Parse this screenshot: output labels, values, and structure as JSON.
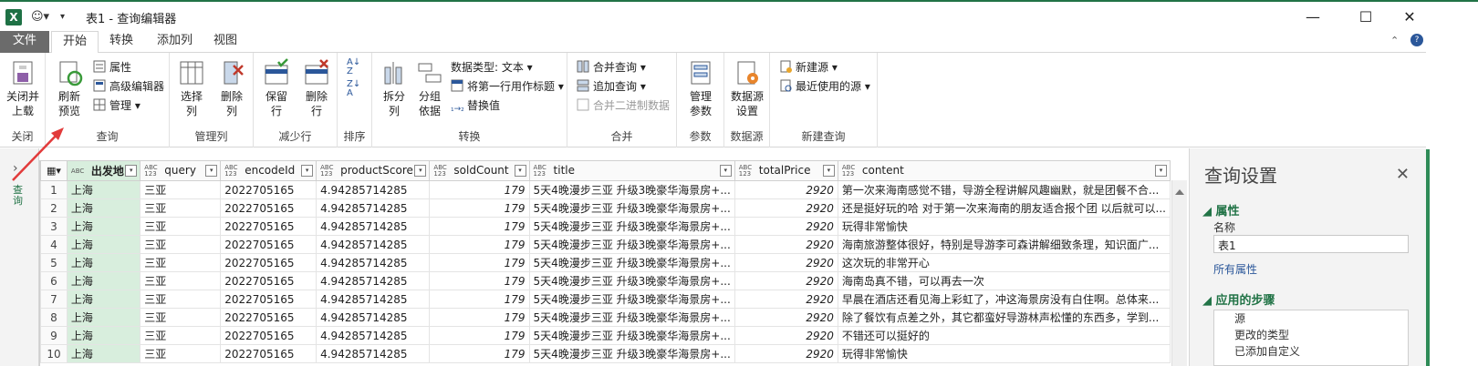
{
  "titlebar": {
    "app_icon": "X",
    "title": "表1 - 查询编辑器",
    "minimize": "—",
    "maximize": "☐",
    "close": "✕"
  },
  "tabs": [
    "文件",
    "开始",
    "转换",
    "添加列",
    "视图"
  ],
  "ribbon": {
    "close_group": {
      "btn": "关闭并\n上载",
      "label": "关闭"
    },
    "query_group": {
      "refresh": "刷新\n预览",
      "props": "属性",
      "adv_editor": "高级编辑器",
      "manage": "管理",
      "label": "查询"
    },
    "manage_cols": {
      "choose": "选择\n列",
      "remove": "删除\n列",
      "label": "管理列"
    },
    "reduce_rows": {
      "keep": "保留\n行",
      "remove": "删除\n行",
      "label": "减少行"
    },
    "sort": {
      "label": "排序"
    },
    "transform": {
      "split": "拆分\n列",
      "group": "分组\n依据",
      "dtype": "数据类型: 文本",
      "first_row": "将第一行用作标题",
      "replace": "替换值",
      "label": "转换"
    },
    "combine": {
      "merge": "合并查询",
      "append": "追加查询",
      "binary": "合并二进制数据",
      "label": "合并"
    },
    "params": {
      "manage": "管理\n参数",
      "label": "参数"
    },
    "datasource": {
      "settings": "数据源\n设置",
      "label": "数据源"
    },
    "newquery": {
      "new_src": "新建源",
      "recent": "最近使用的源",
      "label": "新建查询"
    }
  },
  "leftnav": {
    "label": "查询"
  },
  "grid": {
    "columns": [
      {
        "name": "出发地",
        "type": "ABC"
      },
      {
        "name": "query",
        "type": "ABC\n123"
      },
      {
        "name": "encodeId",
        "type": "ABC\n123"
      },
      {
        "name": "productScore",
        "type": "ABC\n123"
      },
      {
        "name": "soldCount",
        "type": "ABC\n123"
      },
      {
        "name": "title",
        "type": "ABC\n123"
      },
      {
        "name": "totalPrice",
        "type": "ABC\n123"
      },
      {
        "name": "content",
        "type": "ABC\n123"
      }
    ],
    "rows": [
      [
        "1",
        "上海",
        "三亚",
        "2022705165",
        "4.94285714285",
        "179",
        "5天4晚漫步三亚 升级3晚豪华海景房+...",
        "2920",
        "第一次来海南感觉不错，导游全程讲解风趣幽默，就是团餐不合..."
      ],
      [
        "2",
        "上海",
        "三亚",
        "2022705165",
        "4.94285714285",
        "179",
        "5天4晚漫步三亚 升级3晚豪华海景房+...",
        "2920",
        "还是挺好玩的哈 对于第一次来海南的朋友适合报个团 以后就可以..."
      ],
      [
        "3",
        "上海",
        "三亚",
        "2022705165",
        "4.94285714285",
        "179",
        "5天4晚漫步三亚 升级3晚豪华海景房+...",
        "2920",
        "玩得非常愉快"
      ],
      [
        "4",
        "上海",
        "三亚",
        "2022705165",
        "4.94285714285",
        "179",
        "5天4晚漫步三亚 升级3晚豪华海景房+...",
        "2920",
        "海南旅游整体很好，特别是导游李可森讲解细致条理，知识面广..."
      ],
      [
        "5",
        "上海",
        "三亚",
        "2022705165",
        "4.94285714285",
        "179",
        "5天4晚漫步三亚 升级3晚豪华海景房+...",
        "2920",
        "这次玩的非常开心"
      ],
      [
        "6",
        "上海",
        "三亚",
        "2022705165",
        "4.94285714285",
        "179",
        "5天4晚漫步三亚 升级3晚豪华海景房+...",
        "2920",
        "海南岛真不错，可以再去一次"
      ],
      [
        "7",
        "上海",
        "三亚",
        "2022705165",
        "4.94285714285",
        "179",
        "5天4晚漫步三亚 升级3晚豪华海景房+...",
        "2920",
        "早晨在酒店还看见海上彩虹了，冲这海景房没有白住啊。总体来..."
      ],
      [
        "8",
        "上海",
        "三亚",
        "2022705165",
        "4.94285714285",
        "179",
        "5天4晚漫步三亚 升级3晚豪华海景房+...",
        "2920",
        "除了餐饮有点差之外，其它都蛮好导游林声松懂的东西多，学到..."
      ],
      [
        "9",
        "上海",
        "三亚",
        "2022705165",
        "4.94285714285",
        "179",
        "5天4晚漫步三亚 升级3晚豪华海景房+...",
        "2920",
        "不错还可以挺好的"
      ],
      [
        "10",
        "上海",
        "三亚",
        "2022705165",
        "4.94285714285",
        "179",
        "5天4晚漫步三亚 升级3晚豪华海景房+...",
        "2920",
        "玩得非常愉快"
      ]
    ]
  },
  "settings": {
    "title": "查询设置",
    "props_title": "属性",
    "name_label": "名称",
    "name_value": "表1",
    "all_props": "所有属性",
    "steps_title": "应用的步骤",
    "steps": [
      "源",
      "更改的类型",
      "已添加自定义"
    ]
  }
}
